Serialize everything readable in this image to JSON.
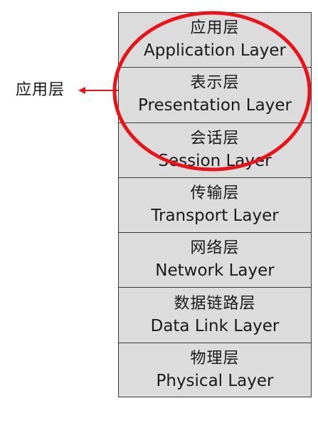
{
  "side_label": "应用层",
  "layers": [
    {
      "cn": "应用层",
      "en": "Application Layer"
    },
    {
      "cn": "表示层",
      "en": "Presentation Layer"
    },
    {
      "cn": "会话层",
      "en": "Session Layer"
    },
    {
      "cn": "传输层",
      "en": "Transport Layer"
    },
    {
      "cn": "网络层",
      "en": "Network Layer"
    },
    {
      "cn": "数据链路层",
      "en": "Data Link Layer"
    },
    {
      "cn": "物理层",
      "en": "Physical Layer"
    }
  ],
  "colors": {
    "box_fill": "#dcdcdc",
    "border": "#3a3a3a",
    "highlight": "#e8141b"
  }
}
